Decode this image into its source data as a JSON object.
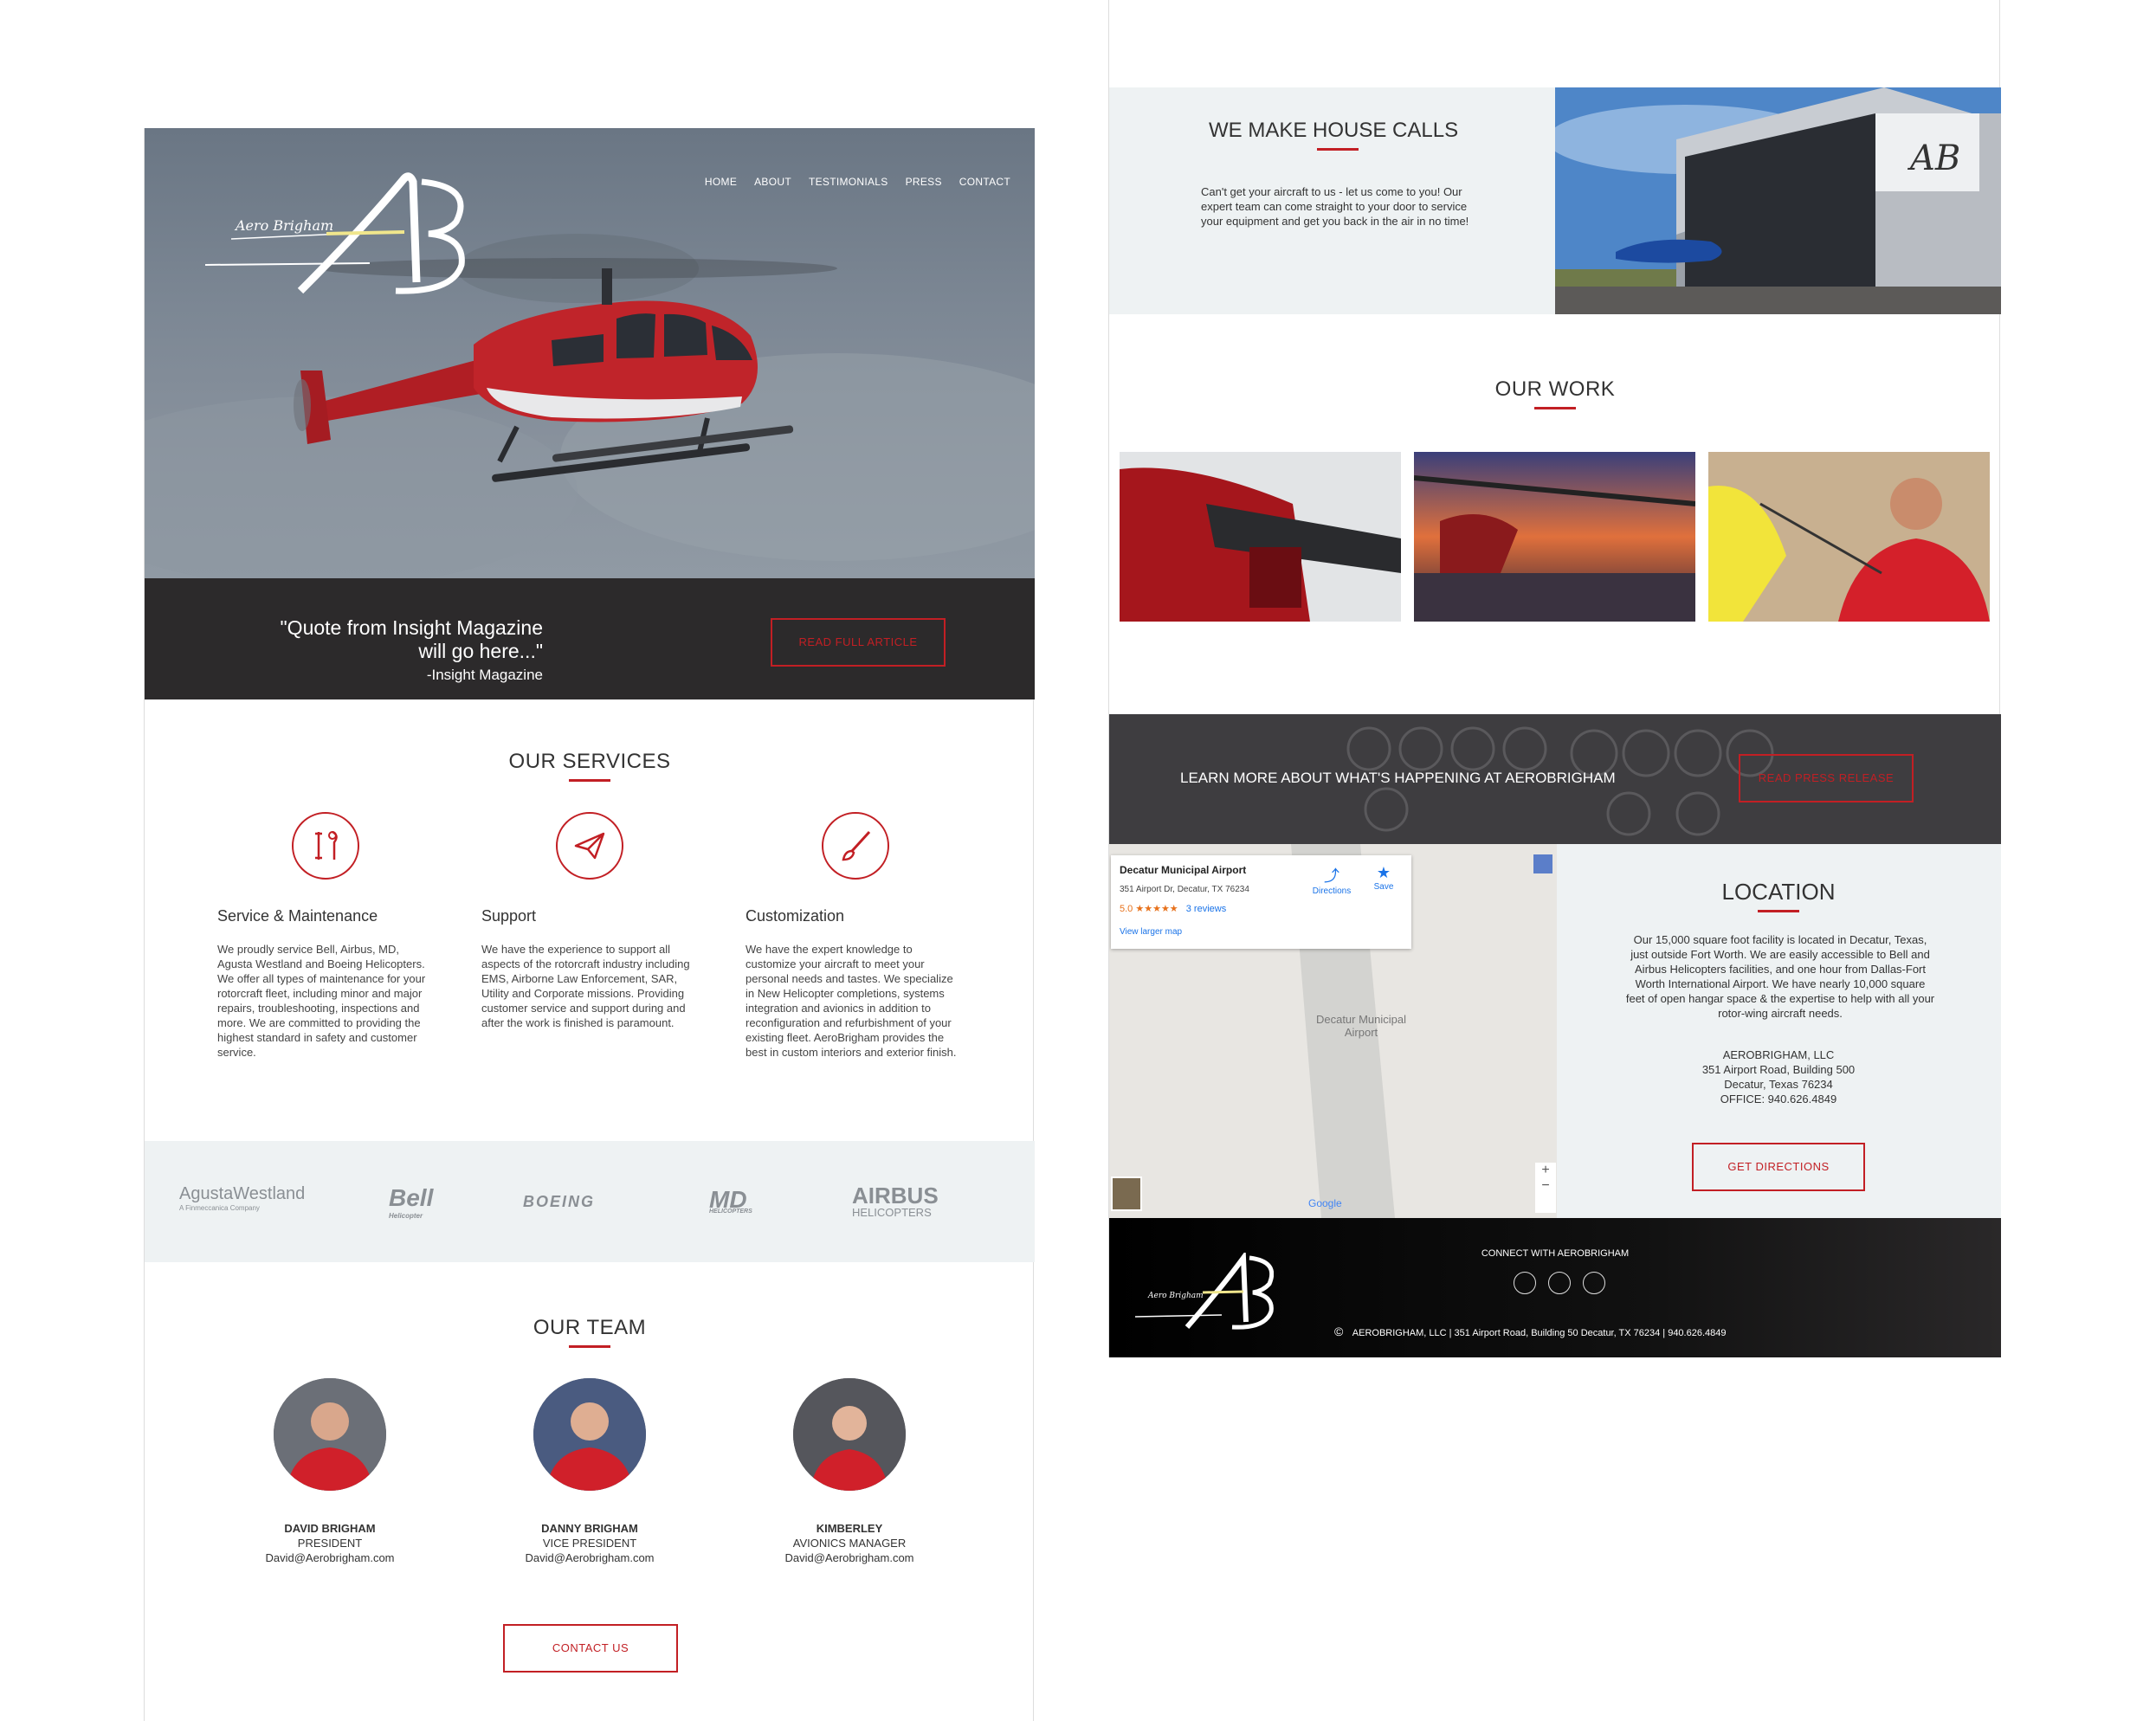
{
  "left_page": {
    "logo": {
      "script": "Aero Brigham",
      "mark": "AB"
    },
    "nav": [
      "HOME",
      "ABOUT",
      "TESTIMONIALS",
      "PRESS",
      "CONTACT"
    ],
    "quote": {
      "text": "\"Quote from Insight Magazine will go here...\"",
      "source": "-Insight Magazine",
      "button": "READ FULL ARTICLE"
    },
    "services": {
      "title": "OUR SERVICES",
      "items": [
        {
          "icon": "tools-icon",
          "title": "Service & Maintenance",
          "text": "We proudly service Bell, Airbus, MD, Agusta Westland and Boeing Helicopters.  We offer all types of maintenance for your rotorcraft fleet, including minor and major repairs, troubleshooting, inspections and more. We are committed to providing the highest standard in safety and customer service."
        },
        {
          "icon": "paper-plane-icon",
          "title": "Support",
          "text": "We have the experience to support all aspects of the rotorcraft industry including EMS, Airborne Law Enforcement, SAR, Utility and Corporate missions. Providing customer service and support during and after the work is finished is paramount."
        },
        {
          "icon": "paintbrush-icon",
          "title": "Customization",
          "text": "We have the expert knowledge to customize your aircraft to meet your personal needs and tastes.  We specialize in New Helicopter completions, systems integration and avionics in addition to reconfiguration and refurbishment of your existing fleet.  AeroBrigham provides the best in custom interiors and exterior finish."
        }
      ]
    },
    "brands": [
      {
        "name": "AgustaWestland",
        "sub": "A Finmeccanica Company"
      },
      {
        "name": "Bell",
        "sub": "Helicopter"
      },
      {
        "name": "BOEING",
        "sub": ""
      },
      {
        "name": "MD",
        "sub": "HELICOPTERS"
      },
      {
        "name": "AIRBUS",
        "sub": "HELICOPTERS"
      }
    ],
    "team": {
      "title": "OUR TEAM",
      "members": [
        {
          "name": "DAVID BRIGHAM",
          "role": "PRESIDENT",
          "email": "David@Aerobrigham.com"
        },
        {
          "name": "DANNY  BRIGHAM",
          "role": "VICE PRESIDENT",
          "email": "David@Aerobrigham.com"
        },
        {
          "name": "KIMBERLEY",
          "role": "AVIONICS MANAGER",
          "email": "David@Aerobrigham.com"
        }
      ],
      "contact_button": "CONTACT US"
    }
  },
  "right_page": {
    "house_calls": {
      "title": "WE MAKE HOUSE CALLS",
      "text": "Can't get your aircraft to us - let us come to you! Our expert team can come straight to your door to service your equipment and get you back in the air in no time!"
    },
    "work": {
      "title": "OUR WORK"
    },
    "press": {
      "text": "LEARN MORE ABOUT WHAT'S HAPPENING AT AEROBRIGHAM",
      "button": "READ PRESS RELEASE"
    },
    "map": {
      "place": "Decatur Municipal Airport",
      "address": "351 Airport Dr, Decatur, TX 76234",
      "rating": "5.0",
      "stars": "★★★★★",
      "reviews": "3 reviews",
      "larger_map": "View larger map",
      "directions": "Directions",
      "save": "Save",
      "map_label": "Decatur Municipal Airport",
      "google": "Google",
      "zoom_in": "+",
      "zoom_out": "−"
    },
    "location": {
      "title": "LOCATION",
      "text": "Our 15,000 square foot facility is located in Decatur, Texas, just outside Fort Worth. We are easily accessible to Bell and Airbus Helicopters facilities, and one hour from Dallas-Fort Worth International Airport. We have nearly 10,000 square feet of open hangar space & the expertise to help with all your rotor-wing aircraft needs.",
      "company": "AEROBRIGHAM, LLC",
      "street": "351 Airport Road, Building 500",
      "city": "Decatur, Texas 76234",
      "office": "OFFICE: 940.626.4849",
      "button": "GET DIRECTIONS"
    },
    "footer": {
      "connect": "CONNECT WITH AEROBRIGHAM",
      "copyright_symbol": "©",
      "copyright": "AEROBRIGHAM, LLC | 351 Airport Road, Building 50 Decatur, TX 76234 | 940.626.4849"
    }
  },
  "colors": {
    "accent": "#c21f24",
    "dark_band": "#2c2a2b",
    "light_band": "#eef2f3"
  }
}
